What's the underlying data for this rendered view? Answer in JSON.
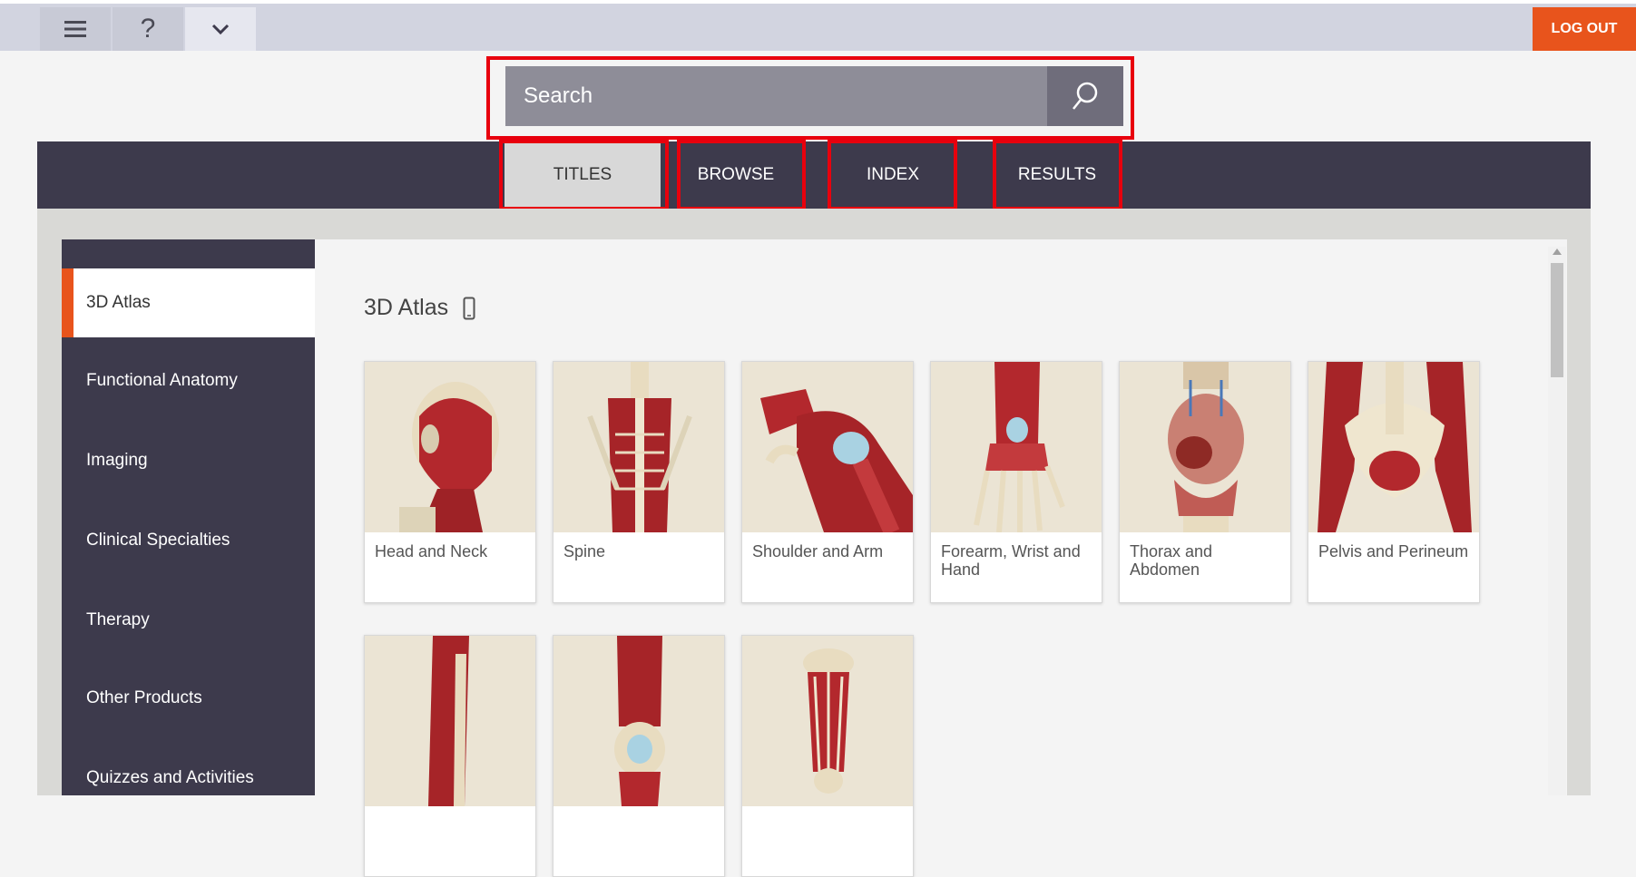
{
  "toolbar": {
    "menu_icon": "hamburger-icon",
    "help_label": "?",
    "more_icon": "chevron-down-icon",
    "logout_label": "LOG OUT"
  },
  "search": {
    "placeholder": "Search",
    "icon": "search-icon"
  },
  "tabs": [
    {
      "label": "TITLES",
      "active": true
    },
    {
      "label": "BROWSE",
      "active": false
    },
    {
      "label": "INDEX",
      "active": false
    },
    {
      "label": "RESULTS",
      "active": false
    }
  ],
  "sidebar": {
    "items": [
      {
        "label": "3D Atlas",
        "active": true
      },
      {
        "label": "Functional Anatomy"
      },
      {
        "label": "Imaging"
      },
      {
        "label": "Clinical Specialties"
      },
      {
        "label": "Therapy"
      },
      {
        "label": "Other Products"
      },
      {
        "label": "Quizzes and Activities"
      }
    ]
  },
  "main": {
    "title": "3D Atlas",
    "title_icon": "mobile-device-icon",
    "cards": [
      {
        "label": "Head and Neck"
      },
      {
        "label": "Spine"
      },
      {
        "label": "Shoulder and Arm"
      },
      {
        "label": "Forearm, Wrist and Hand"
      },
      {
        "label": "Thorax and Abdomen"
      },
      {
        "label": "Pelvis and Perineum"
      },
      {
        "label": ""
      },
      {
        "label": ""
      },
      {
        "label": ""
      }
    ]
  },
  "colors": {
    "accent": "#e8541c",
    "nav_dark": "#3d3a4c",
    "highlight": "#e8000d"
  }
}
